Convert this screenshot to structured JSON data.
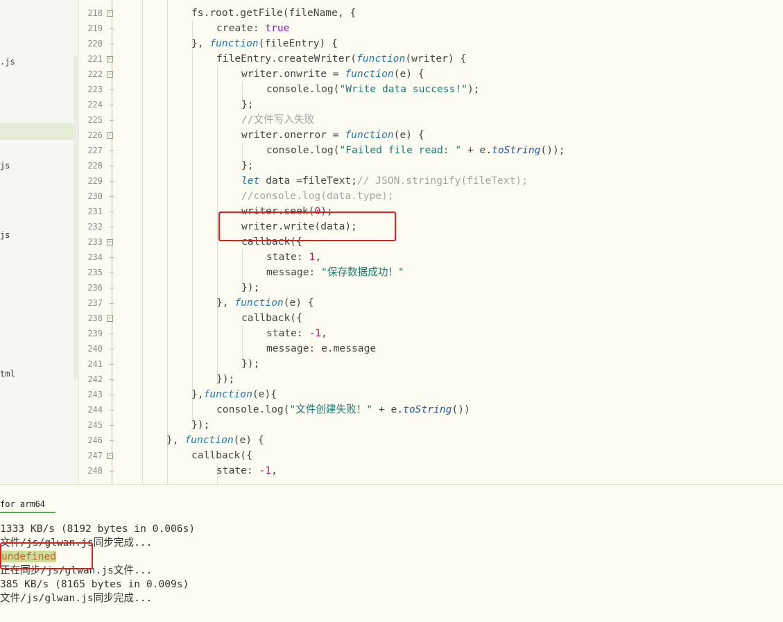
{
  "sidebar": {
    "items": [
      ".js",
      "js",
      "js",
      "tml"
    ]
  },
  "editor": {
    "lines": [
      {
        "num": "218",
        "fold": true
      },
      {
        "num": "219"
      },
      {
        "num": "220"
      },
      {
        "num": "221",
        "fold": true
      },
      {
        "num": "222",
        "fold": true
      },
      {
        "num": "223"
      },
      {
        "num": "224"
      },
      {
        "num": "225"
      },
      {
        "num": "226",
        "fold": true
      },
      {
        "num": "227"
      },
      {
        "num": "228"
      },
      {
        "num": "229"
      },
      {
        "num": "230"
      },
      {
        "num": "231"
      },
      {
        "num": "232"
      },
      {
        "num": "233",
        "fold": true
      },
      {
        "num": "234"
      },
      {
        "num": "235"
      },
      {
        "num": "236"
      },
      {
        "num": "237"
      },
      {
        "num": "238",
        "fold": true
      },
      {
        "num": "239"
      },
      {
        "num": "240"
      },
      {
        "num": "241"
      },
      {
        "num": "242"
      },
      {
        "num": "243"
      },
      {
        "num": "244"
      },
      {
        "num": "245"
      },
      {
        "num": "246"
      },
      {
        "num": "247",
        "fold": true
      },
      {
        "num": "248"
      }
    ],
    "code": {
      "l218a": "fs.root.getFile(fileName, {",
      "l219a": "create: ",
      "l219b": "true",
      "l220a": "}, ",
      "l220b": "function",
      "l220c": "(fileEntry) {",
      "l221a": "fileEntry.createWriter(",
      "l221b": "function",
      "l221c": "(writer) {",
      "l222a": "writer.onwrite = ",
      "l222b": "function",
      "l222c": "(e) {",
      "l223a": "console.log(",
      "l223b": "\"Write data success!\"",
      "l223c": ");",
      "l224a": "};",
      "l225a": "//文件写入失败",
      "l226a": "writer.onerror = ",
      "l226b": "function",
      "l226c": "(e) {",
      "l227a": "console.log(",
      "l227b": "\"Failed file read: \"",
      "l227c": " + e.",
      "l227d": "toString",
      "l227e": "());",
      "l228a": "};",
      "l229a": "let",
      "l229b": " data =fileText;",
      "l229c": "// JSON.stringify(fileText);",
      "l230a": "//console.log(data.type);",
      "l231a": "writer.seek(",
      "l231b": "0",
      "l231c": ");",
      "l232a": "writer.write(data);",
      "l233a": "callback({",
      "l234a": "state: ",
      "l234b": "1",
      "l234c": ",",
      "l235a": "message: ",
      "l235b": "\"保存数据成功！\"",
      "l236a": "});",
      "l237a": "}, ",
      "l237b": "function",
      "l237c": "(e) {",
      "l238a": "callback({",
      "l239a": "state: ",
      "l239b": "-1",
      "l239c": ",",
      "l240a": "message: e.message",
      "l241a": "});",
      "l242a": "});",
      "l243a": "},",
      "l243b": "function",
      "l243c": "(e){",
      "l244a": "console.log(",
      "l244b": "\"文件创建失败！\"",
      "l244c": " + e.",
      "l244d": "toString",
      "l244e": "())",
      "l245a": "});",
      "l246a": "}, ",
      "l246b": "function",
      "l246c": "(e) {",
      "l247a": "callback({",
      "l248a": "state: ",
      "l248b": "-1",
      "l248c": ","
    }
  },
  "console": {
    "tab_label": "for arm64",
    "lines": [
      "1333 KB/s (8192 bytes in 0.006s)",
      "文件/js/glwan.js同步完成...",
      "undefined",
      "正在同步/js/glwan.js文件...",
      "385 KB/s (8165 bytes in 0.009s)",
      "文件/js/glwan.js同步完成..."
    ]
  },
  "colors": {
    "highlight_box": "#e21b1b",
    "keyword": "#1e7ab5",
    "string": "#1a7c6e",
    "comment": "#a3a3a3",
    "number": "#c2185b"
  }
}
